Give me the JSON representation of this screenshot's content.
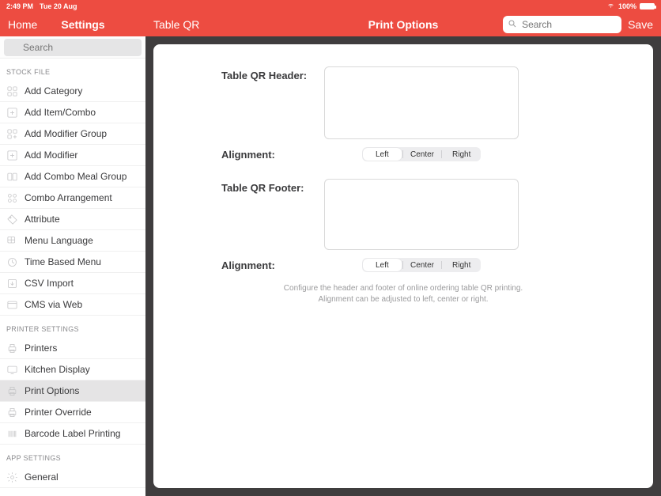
{
  "status": {
    "time": "2:49 PM",
    "date": "Tue 20 Aug",
    "battery": "100%"
  },
  "leftHeader": {
    "home": "Home",
    "settings": "Settings"
  },
  "leftSearch": {
    "placeholder": "Search"
  },
  "sections": {
    "s1": "STOCK FILE",
    "s2": "PRINTER SETTINGS",
    "s3": "APP SETTINGS"
  },
  "sidebar": {
    "stock": {
      "i0": "Add Category",
      "i1": "Add Item/Combo",
      "i2": "Add Modifier Group",
      "i3": "Add Modifier",
      "i4": "Add Combo Meal Group",
      "i5": "Combo Arrangement",
      "i6": "Attribute",
      "i7": "Menu Language",
      "i8": "Time Based Menu",
      "i9": "CSV Import",
      "i10": "CMS via Web"
    },
    "printer": {
      "p0": "Printers",
      "p1": "Kitchen Display",
      "p2": "Print Options",
      "p3": "Printer Override",
      "p4": "Barcode Label Printing"
    },
    "app": {
      "a0": "General"
    }
  },
  "rightHeader": {
    "left": "Table QR",
    "center": "Print Options",
    "save": "Save"
  },
  "rightSearch": {
    "placeholder": "Search"
  },
  "form": {
    "headerLabel": "Table QR Header:",
    "footerLabel": "Table QR Footer:",
    "alignmentLabel": "Alignment:",
    "alignmentLabel2": "Alignment:",
    "seg": {
      "left": "Left",
      "center": "Center",
      "right": "Right"
    },
    "help1": "Configure the header and footer of online ordering table QR printing.",
    "help2": "Alignment can be adjusted to left, center or right."
  }
}
